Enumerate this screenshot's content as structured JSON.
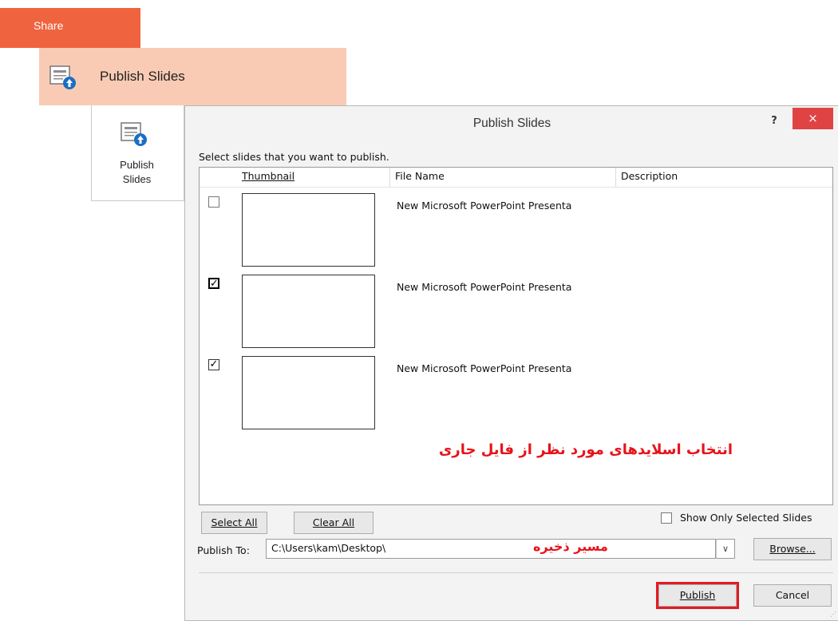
{
  "ribbon": {
    "share_tab": "Share",
    "publish_row_label": "Publish Slides",
    "big_button_label_line1": "Publish",
    "big_button_label_line2": "Slides"
  },
  "dialog": {
    "title": "Publish Slides",
    "help": "?",
    "close": "×",
    "instruction": "Select slides that you want to publish.",
    "columns": {
      "thumbnail": "Thumbnail",
      "file_name": "File Name",
      "description": "Description"
    },
    "slides": [
      {
        "file_name": "New Microsoft PowerPoint Presenta",
        "checked": false
      },
      {
        "file_name": "New Microsoft PowerPoint Presenta",
        "checked": true
      },
      {
        "file_name": "New Microsoft PowerPoint Presenta",
        "checked": true
      }
    ],
    "annotation_select": "انتخاب اسلایدهای مورد نظر از فایل جاری",
    "annotation_path": "مسیر ذخیره",
    "select_all": "Select All",
    "clear_all": "Clear All",
    "show_only_selected": "Show Only Selected Slides",
    "publish_to_label": "Publish To:",
    "publish_to_value": "C:\\Users\\kam\\Desktop\\",
    "browse": "Browse...",
    "publish": "Publish",
    "cancel": "Cancel",
    "highlight_color": "#e11b22",
    "close_color": "#e04343"
  }
}
